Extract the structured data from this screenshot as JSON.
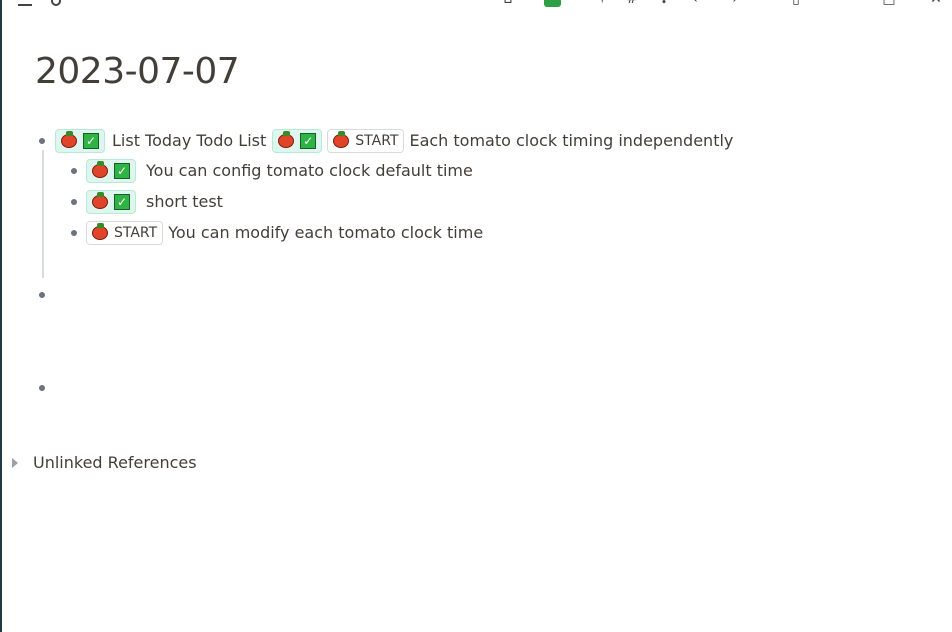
{
  "page": {
    "title": "2023-07-07"
  },
  "toolbar": {
    "icons": [
      "menu-icon",
      "search-icon",
      "home-icon",
      "sync-status-icon",
      "graph-icon",
      "tag-icon",
      "plugin-icon",
      "back-icon",
      "forward-icon",
      "more-icon",
      "sidebar-icon",
      "maximize-icon",
      "close-icon"
    ],
    "green_color": "#2ea043"
  },
  "blocks": [
    {
      "level": 0,
      "segments": [
        {
          "type": "chip-done"
        },
        {
          "type": "text",
          "value": "List Today Todo List"
        },
        {
          "type": "chip-done"
        },
        {
          "type": "chip-start",
          "label": "START"
        },
        {
          "type": "text",
          "value": "Each tomato clock timing independently"
        }
      ]
    },
    {
      "level": 1,
      "segments": [
        {
          "type": "chip-done"
        },
        {
          "type": "text",
          "value": "You can config tomato clock default time"
        }
      ]
    },
    {
      "level": 1,
      "segments": [
        {
          "type": "chip-done"
        },
        {
          "type": "text",
          "value": "short test"
        }
      ]
    },
    {
      "level": 1,
      "segments": [
        {
          "type": "chip-start",
          "label": "START"
        },
        {
          "type": "text",
          "value": "You can modify each tomato clock time"
        }
      ]
    },
    {
      "level": 0,
      "segments": []
    },
    {
      "level": 0,
      "segments": []
    }
  ],
  "references": {
    "unlinked_label": "Unlinked References"
  },
  "colors": {
    "tomato": "#e0452a",
    "check": "#2fb344",
    "chip_done_bg": "#dff6ee"
  }
}
